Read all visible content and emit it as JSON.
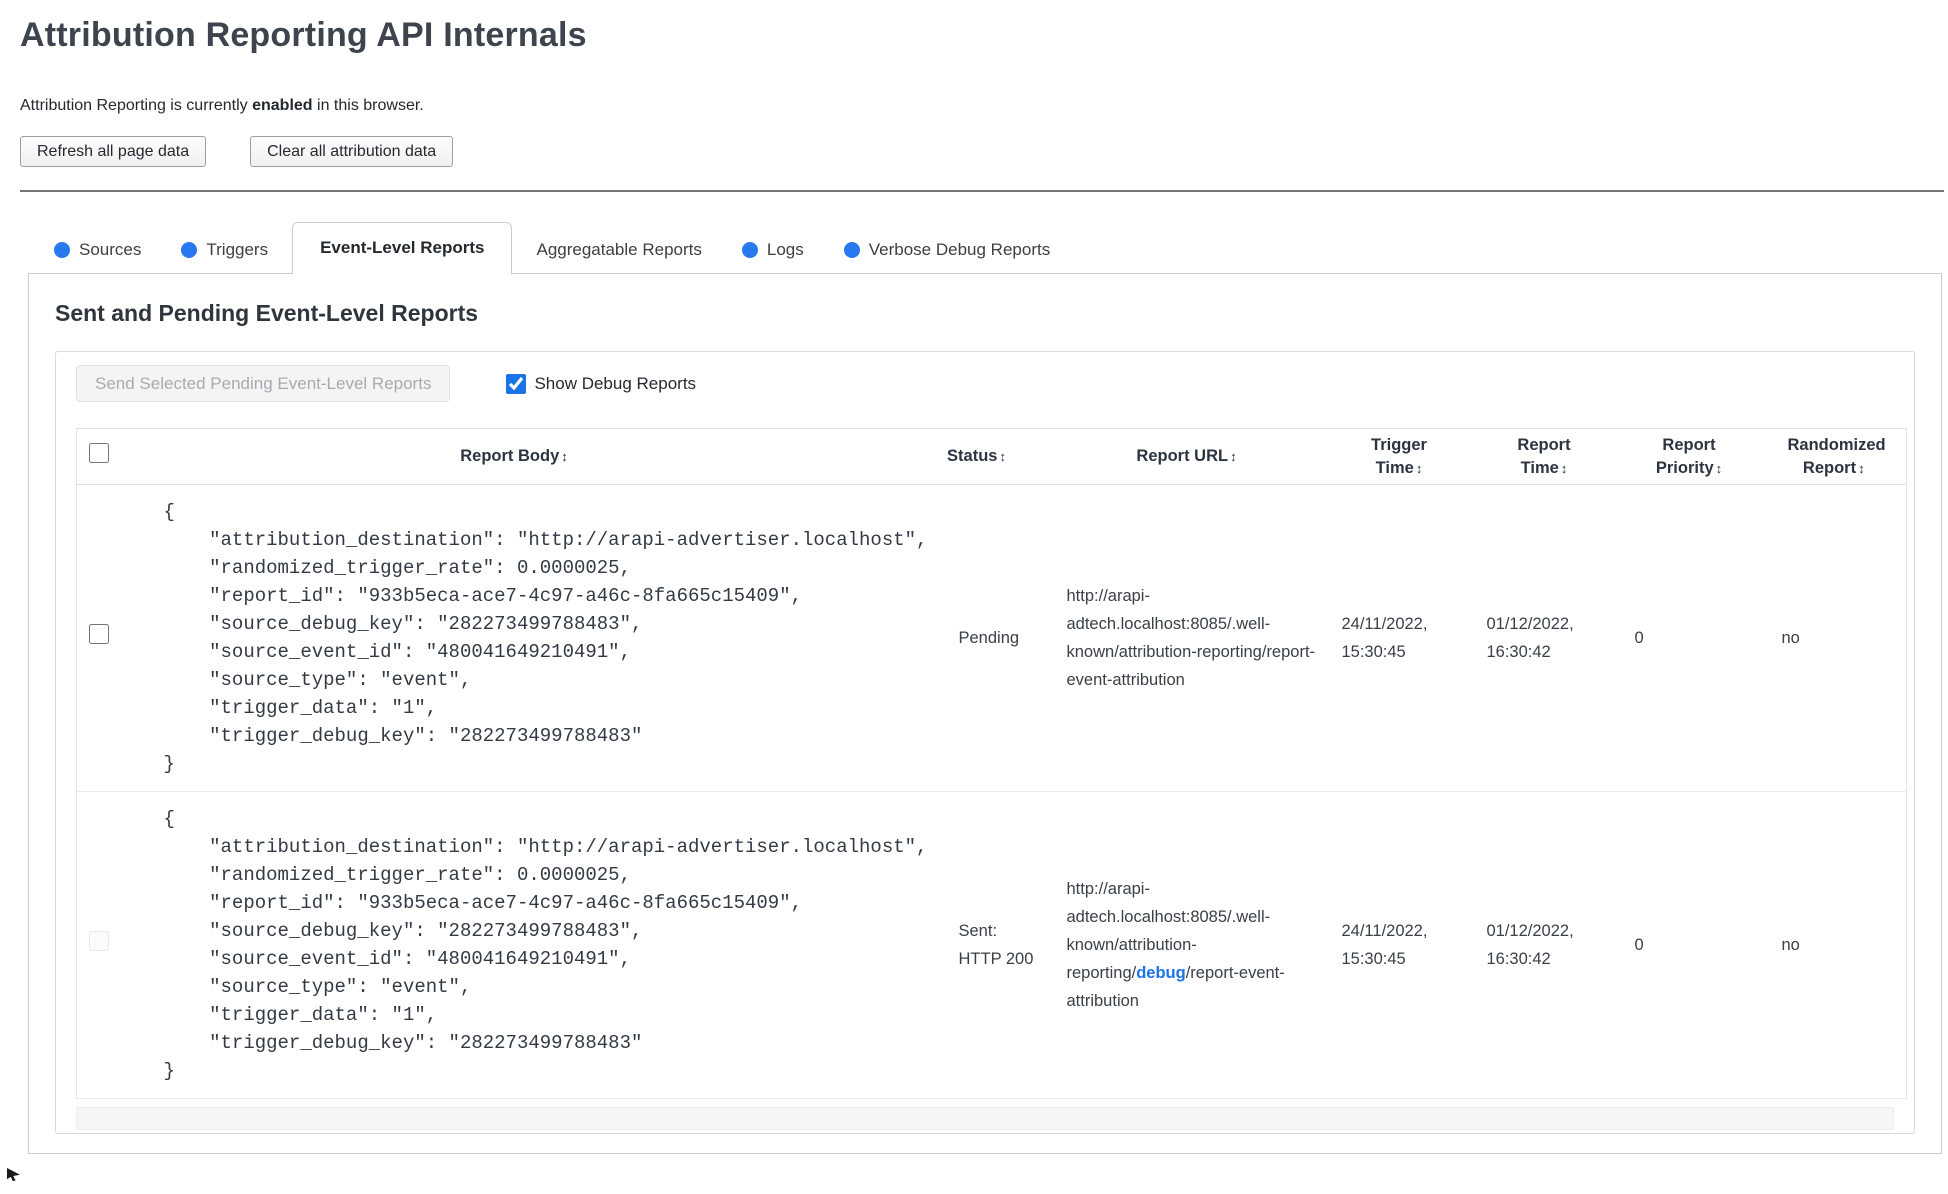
{
  "header": {
    "title": "Attribution Reporting API Internals",
    "status_prefix": "Attribution Reporting is currently ",
    "status_bold": "enabled",
    "status_suffix": " in this browser.",
    "refresh_button": "Refresh all page data",
    "clear_button": "Clear all attribution data"
  },
  "colors": {
    "tab_dot_blue": "#2879f0",
    "link_blue": "#1a73e8"
  },
  "tabs": {
    "items": [
      {
        "label": "Sources",
        "has_dot": true,
        "active": false
      },
      {
        "label": "Triggers",
        "has_dot": true,
        "active": false
      },
      {
        "label": "Event-Level Reports",
        "has_dot": false,
        "active": true
      },
      {
        "label": "Aggregatable Reports",
        "has_dot": false,
        "active": false
      },
      {
        "label": "Logs",
        "has_dot": true,
        "active": false
      },
      {
        "label": "Verbose Debug Reports",
        "has_dot": true,
        "active": false
      }
    ]
  },
  "section": {
    "heading": "Sent and Pending Event-Level Reports",
    "send_button": "Send Selected Pending Event-Level Reports",
    "show_debug_label": "Show Debug Reports",
    "show_debug_checked": "checked"
  },
  "table": {
    "sort_icon": "↕",
    "columns": [
      "Report Body",
      "Status",
      "Report URL",
      "Trigger Time",
      "Report Time",
      "Report Priority",
      "Randomized Report"
    ],
    "rows": [
      {
        "report_body": "{\n    \"attribution_destination\": \"http://arapi-advertiser.localhost\",\n    \"randomized_trigger_rate\": 0.0000025,\n    \"report_id\": \"933b5eca-ace7-4c97-a46c-8fa665c15409\",\n    \"source_debug_key\": \"282273499788483\",\n    \"source_event_id\": \"480041649210491\",\n    \"source_type\": \"event\",\n    \"trigger_data\": \"1\",\n    \"trigger_debug_key\": \"282273499788483\"\n}",
        "status": "Pending",
        "url_prefix": "http://arapi-adtech.localhost:8085/.well-known/attribution-reporting/report-event-attribution",
        "url_link": "",
        "url_suffix": "",
        "trigger_time": "24/11/2022, 15:30:45",
        "report_time": "01/12/2022, 16:30:42",
        "report_priority": "0",
        "randomized_report": "no"
      },
      {
        "report_body": "{\n    \"attribution_destination\": \"http://arapi-advertiser.localhost\",\n    \"randomized_trigger_rate\": 0.0000025,\n    \"report_id\": \"933b5eca-ace7-4c97-a46c-8fa665c15409\",\n    \"source_debug_key\": \"282273499788483\",\n    \"source_event_id\": \"480041649210491\",\n    \"source_type\": \"event\",\n    \"trigger_data\": \"1\",\n    \"trigger_debug_key\": \"282273499788483\"\n}",
        "status": "Sent: HTTP 200",
        "url_prefix": "http://arapi-adtech.localhost:8085/.well-known/attribution-reporting/",
        "url_link": "debug",
        "url_suffix": "/report-event-attribution",
        "trigger_time": "24/11/2022, 15:30:45",
        "report_time": "01/12/2022, 16:30:42",
        "report_priority": "0",
        "randomized_report": "no",
        "checkbox_disabled": "disabled"
      }
    ]
  }
}
